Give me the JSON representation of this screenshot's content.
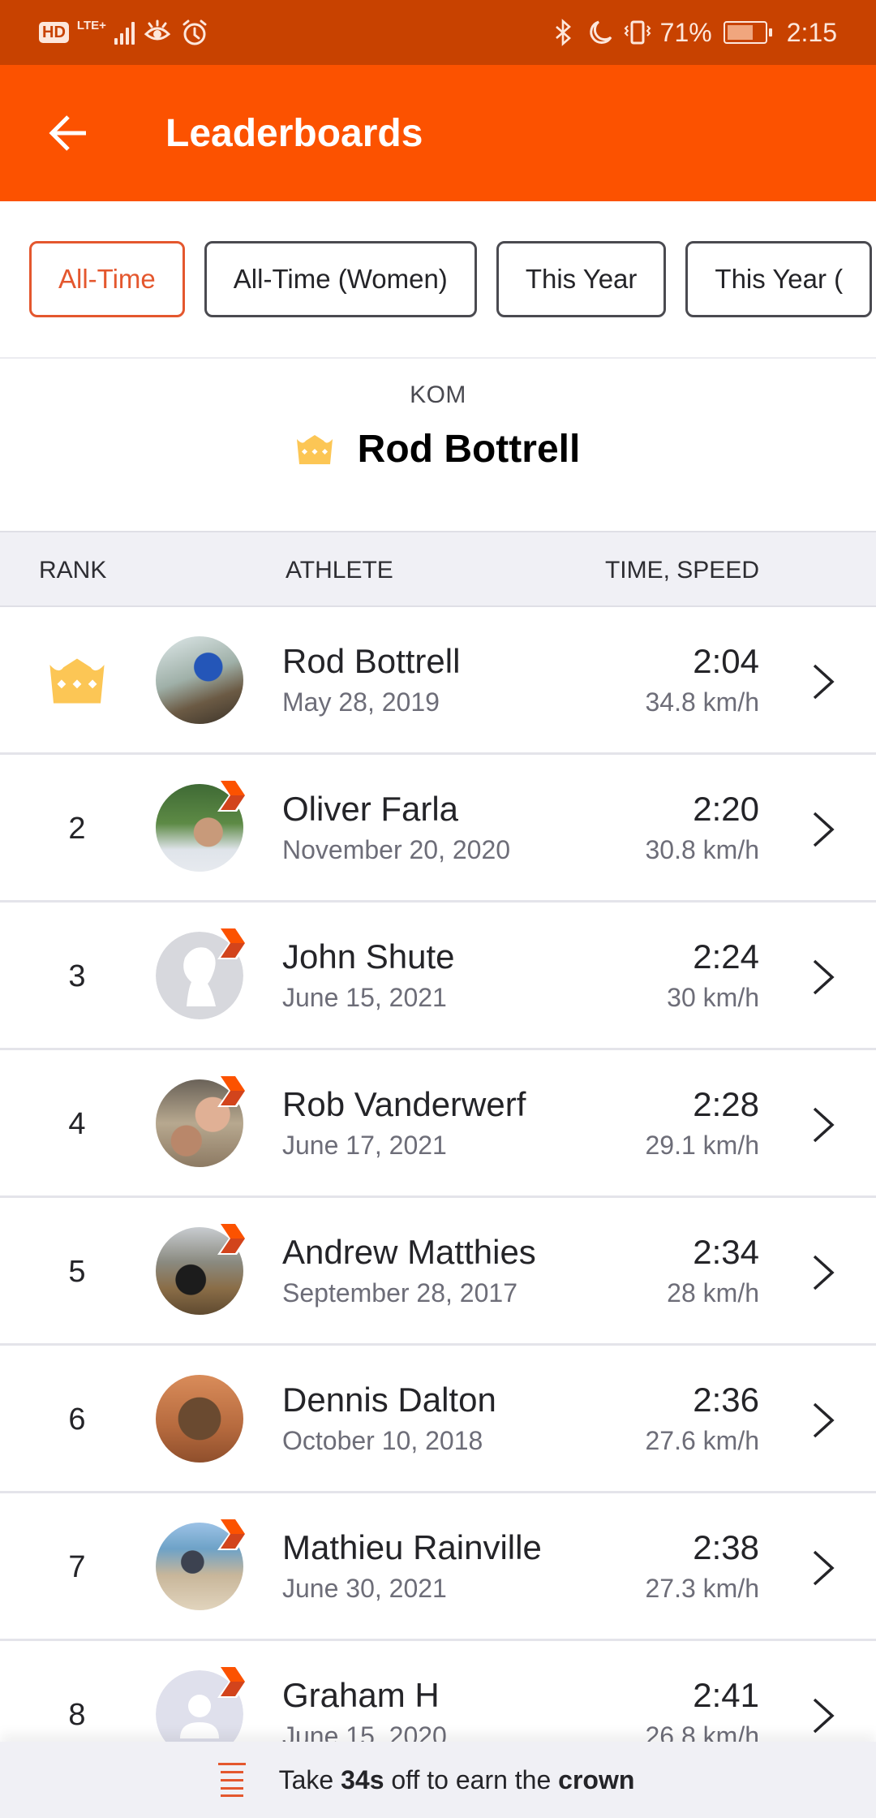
{
  "status_bar": {
    "hd": "HD",
    "network": "LTE+",
    "battery_percent": "71%",
    "battery_level": 0.71,
    "time": "2:15"
  },
  "app_bar": {
    "title": "Leaderboards",
    "back_icon": "arrow-left-icon"
  },
  "filters": [
    {
      "label": "All-Time",
      "active": true
    },
    {
      "label": "All-Time (Women)",
      "active": false
    },
    {
      "label": "This Year",
      "active": false
    },
    {
      "label": "This Year (",
      "active": false
    }
  ],
  "kom": {
    "label": "KOM",
    "holder": "Rod Bottrell",
    "icon": "crown-icon"
  },
  "table": {
    "headers": {
      "rank": "RANK",
      "athlete": "ATHLETE",
      "time": "TIME, SPEED"
    },
    "rows": [
      {
        "rank": "",
        "crown": true,
        "name": "Rod Bottrell",
        "date": "May 28, 2019",
        "time": "2:04",
        "speed": "34.8 km/h",
        "subscriber": false,
        "avatar": "cyclist-forest"
      },
      {
        "rank": "2",
        "crown": false,
        "name": "Oliver Farla",
        "date": "November 20, 2020",
        "time": "2:20",
        "speed": "30.8 km/h",
        "subscriber": true,
        "avatar": "man-eating-grapes"
      },
      {
        "rank": "3",
        "crown": false,
        "name": "John Shute",
        "date": "June 15, 2021",
        "time": "2:24",
        "speed": "30 km/h",
        "subscriber": true,
        "avatar": "default-silhouette"
      },
      {
        "rank": "4",
        "crown": false,
        "name": "Rob Vanderwerf",
        "date": "June 17, 2021",
        "time": "2:28",
        "speed": "29.1 km/h",
        "subscriber": true,
        "avatar": "couple-selfie"
      },
      {
        "rank": "5",
        "crown": false,
        "name": "Andrew Matthies",
        "date": "September 28, 2017",
        "time": "2:34",
        "speed": "28 km/h",
        "subscriber": true,
        "avatar": "fat-bike"
      },
      {
        "rank": "6",
        "crown": false,
        "name": "Dennis Dalton",
        "date": "October 10, 2018",
        "time": "2:36",
        "speed": "27.6 km/h",
        "subscriber": false,
        "avatar": "dog"
      },
      {
        "rank": "7",
        "crown": false,
        "name": "Mathieu Rainville",
        "date": "June 30, 2021",
        "time": "2:38",
        "speed": "27.3 km/h",
        "subscriber": true,
        "avatar": "father-son-bikes"
      },
      {
        "rank": "8",
        "crown": false,
        "name": "Graham H",
        "date": "June 15, 2020",
        "time": "2:41",
        "speed": "26.8 km/h",
        "subscriber": true,
        "avatar": "default-person"
      }
    ]
  },
  "banner": {
    "prefix": "Take ",
    "amount": "34s",
    "middle": " off to earn the ",
    "target": "crown"
  },
  "colors": {
    "brand": "#fc5200",
    "status_bar": "#c84200",
    "active_chip": "#e4572e",
    "crown": "#fcc655"
  }
}
